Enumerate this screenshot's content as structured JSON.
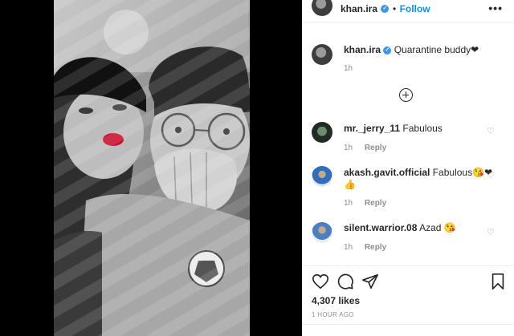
{
  "post": {
    "author": "khan.ira",
    "verified_mark": "✓",
    "separator": "•",
    "follow_label": "Follow",
    "more_label": "•••",
    "caption_user": "khan.ira",
    "caption_text": "Quarantine buddy❤",
    "caption_age": "1h",
    "likes": "4,307 likes",
    "posted": "1 HOUR AGO"
  },
  "comments": [
    {
      "user": "mr._jerry_11",
      "text": "Fabulous",
      "age": "1h",
      "reply_label": "Reply"
    },
    {
      "user": "akash.gavit.official",
      "text": "Fabulous😘❤",
      "text_extra": "👍",
      "age": "1h",
      "reply_label": "Reply"
    },
    {
      "user": "silent.warrior.08",
      "text": "Azad 😘",
      "age": "1h",
      "reply_label": "Reply"
    }
  ],
  "icons": {
    "more_comments": "plus-circle-icon",
    "like": "heart-icon",
    "comment": "comment-bubble-icon",
    "share": "paper-plane-icon",
    "save": "bookmark-icon",
    "comment_like": "heart-icon"
  },
  "colors": {
    "link": "#0095f6",
    "verified": "#3897f0",
    "muted": "#8e8e8e",
    "text": "#262626",
    "lips": "#c8102e"
  }
}
